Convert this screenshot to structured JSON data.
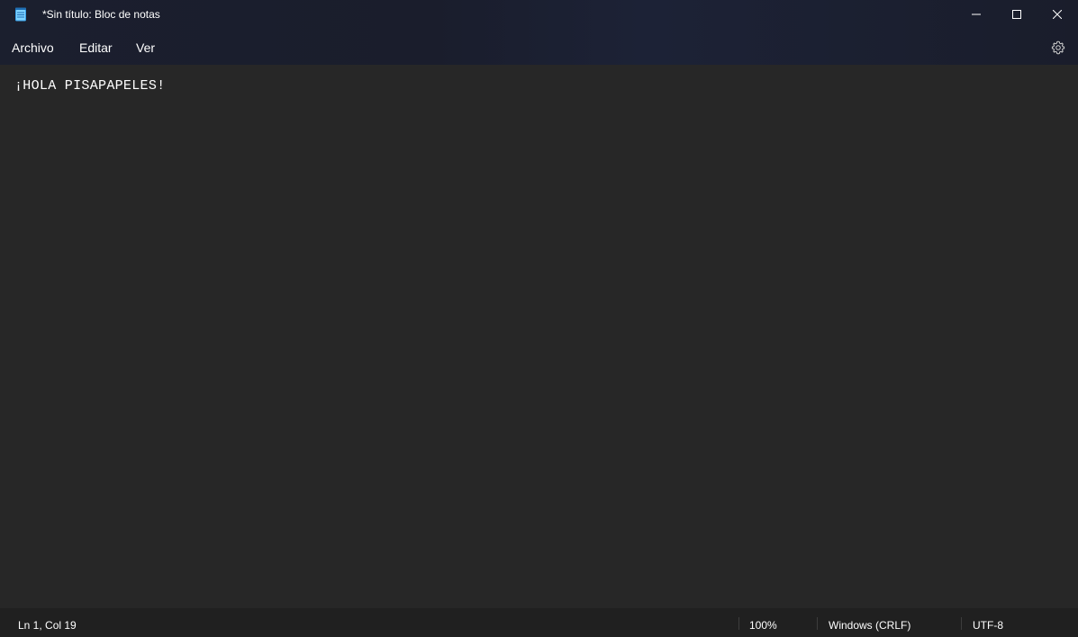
{
  "window": {
    "title": "*Sin título: Bloc de notas",
    "app_icon": "notepad-icon",
    "controls": {
      "minimize_icon": "minimize-icon",
      "maximize_icon": "maximize-icon",
      "close_icon": "close-icon"
    }
  },
  "menu": {
    "items": [
      {
        "label": "Archivo"
      },
      {
        "label": "Editar"
      },
      {
        "label": "Ver"
      }
    ],
    "settings_icon": "gear-icon"
  },
  "editor": {
    "content": "¡HOLA PISAPAPELES!"
  },
  "status": {
    "position": "Ln 1, Col 19",
    "zoom": "100%",
    "line_ending": "Windows (CRLF)",
    "encoding": "UTF-8"
  },
  "colors": {
    "chrome_bg": "#1b1f2e",
    "editor_bg": "#272727",
    "status_bg": "#202020",
    "accent": "#4cc2ff",
    "text": "#ffffff"
  }
}
